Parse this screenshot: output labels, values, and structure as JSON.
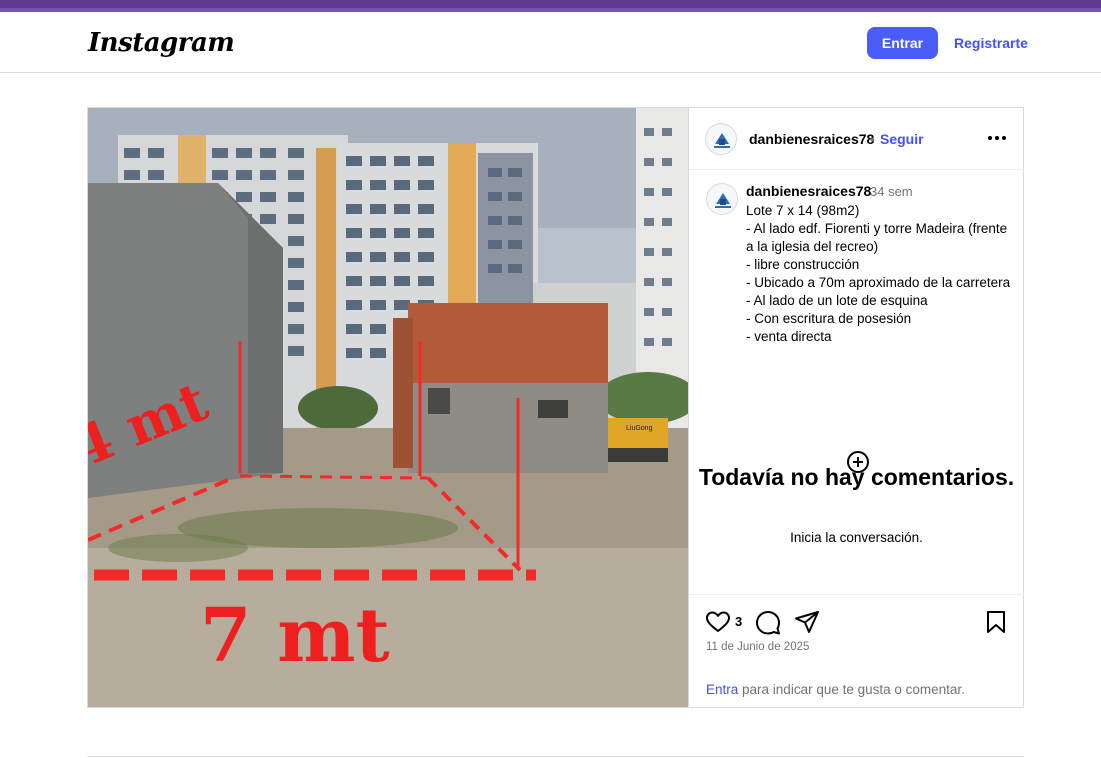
{
  "header": {
    "logo": "Instagram",
    "login_label": "Entrar",
    "register_label": "Registrarte"
  },
  "post": {
    "username": "danbienesraices78",
    "separator": "•",
    "follow_label": "Seguir",
    "caption": {
      "username": "danbienesraices78",
      "time": "34 sem",
      "lines": [
        "Lote 7 x 14 (98m2)",
        "- Al lado edf. Fiorenti y torre Madeira (frente a la iglesia del recreo)",
        "- libre construcción",
        "- Ubicado a 70m aproximado de la carretera",
        "- Al lado de un lote de esquina",
        "- Con escritura de posesión",
        "- venta directa"
      ]
    },
    "image_labels": {
      "left_measure": "4 mt",
      "bottom_measure": "7 mt",
      "machine_brand": "LiuGong"
    },
    "comments": {
      "empty_title": "Todavía no hay comentarios.",
      "empty_subtitle": "Inicia la conversación."
    },
    "likes": "3",
    "date": "11 de Junio de 2025",
    "login_prompt": {
      "link": "Entra",
      "text": " para indicar que te gusta o comentar."
    }
  },
  "colors": {
    "accent_bar": "#5b3a8f",
    "primary_button": "#4a5df9",
    "link": "#4150f7",
    "muted_text": "#737373",
    "border": "#dbdbdb",
    "measure_red": "#f22a2a"
  },
  "icons": {
    "more": "more-horizontal-icon",
    "add_comment": "plus-circle-icon",
    "like": "heart-icon",
    "comment": "comment-bubble-icon",
    "share": "send-icon",
    "save": "bookmark-icon"
  }
}
